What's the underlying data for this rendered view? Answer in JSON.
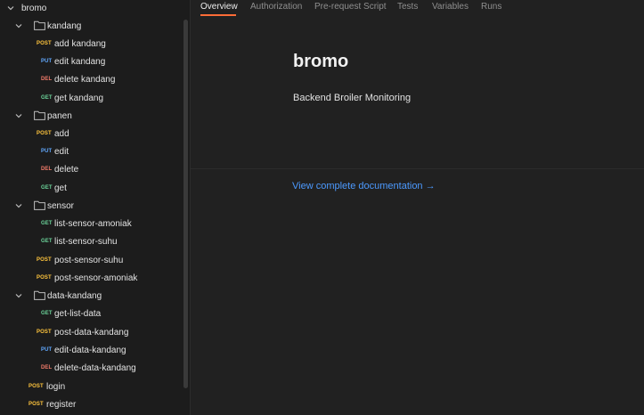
{
  "sidebar": {
    "root": {
      "label": "bromo"
    },
    "folders": [
      {
        "label": "kandang"
      },
      {
        "label": "panen"
      },
      {
        "label": "sensor"
      },
      {
        "label": "data-kandang"
      }
    ],
    "requests": [
      {
        "method": "POST",
        "label": "add kandang"
      },
      {
        "method": "PUT",
        "label": "edit kandang"
      },
      {
        "method": "DEL",
        "label": "delete kandang"
      },
      {
        "method": "GET",
        "label": "get kandang"
      },
      {
        "method": "POST",
        "label": "add"
      },
      {
        "method": "PUT",
        "label": "edit"
      },
      {
        "method": "DEL",
        "label": "delete"
      },
      {
        "method": "GET",
        "label": "get"
      },
      {
        "method": "GET",
        "label": "list-sensor-amoniak"
      },
      {
        "method": "GET",
        "label": "list-sensor-suhu"
      },
      {
        "method": "POST",
        "label": "post-sensor-suhu"
      },
      {
        "method": "POST",
        "label": "post-sensor-amoniak"
      },
      {
        "method": "GET",
        "label": "get-list-data"
      },
      {
        "method": "POST",
        "label": "post-data-kandang"
      },
      {
        "method": "PUT",
        "label": "edit-data-kandang"
      },
      {
        "method": "DEL",
        "label": "delete-data-kandang"
      },
      {
        "method": "POST",
        "label": "login"
      },
      {
        "method": "POST",
        "label": "register"
      }
    ]
  },
  "tabs": [
    "Overview",
    "Authorization",
    "Pre-request Script",
    "Tests",
    "Variables",
    "Runs"
  ],
  "overview": {
    "title": "bromo",
    "description": "Backend Broiler Monitoring",
    "doc_link": "View complete documentation →"
  },
  "colors": {
    "accent": "#ff6c37",
    "post": "#ffc53d",
    "put": "#61a9ff",
    "del": "#f07b6a",
    "get": "#6bd49a",
    "link": "#4c9aff"
  }
}
